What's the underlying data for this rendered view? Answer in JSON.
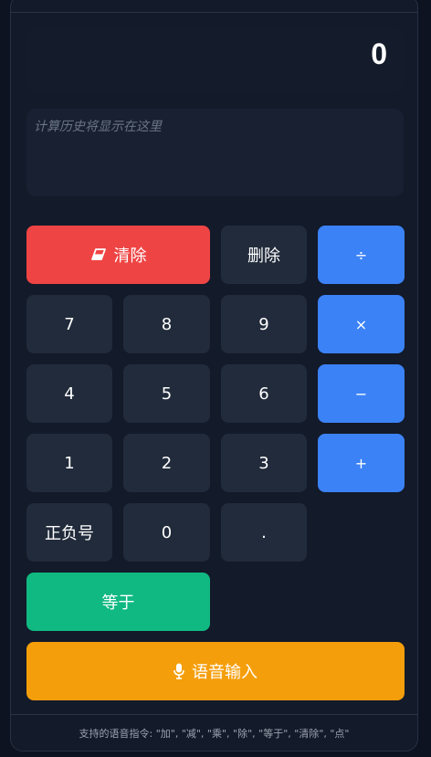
{
  "display": {
    "value": "0"
  },
  "history": {
    "placeholder": "计算历史将显示在这里"
  },
  "buttons": {
    "clear": {
      "label": "清除",
      "icon": "eraser-icon"
    },
    "delete": {
      "label": "删除"
    },
    "divide": {
      "label": "÷"
    },
    "seven": {
      "label": "7"
    },
    "eight": {
      "label": "8"
    },
    "nine": {
      "label": "9"
    },
    "multiply": {
      "label": "×"
    },
    "four": {
      "label": "4"
    },
    "five": {
      "label": "5"
    },
    "six": {
      "label": "6"
    },
    "subtract": {
      "label": "−"
    },
    "one": {
      "label": "1"
    },
    "two": {
      "label": "2"
    },
    "three": {
      "label": "3"
    },
    "add": {
      "label": "+"
    },
    "negate": {
      "label": "正负号"
    },
    "zero": {
      "label": "0"
    },
    "decimal": {
      "label": "."
    },
    "equals": {
      "label": "等于"
    },
    "voice": {
      "label": "语音输入",
      "icon": "microphone-icon"
    }
  },
  "footer": {
    "text": "支持的语音指令: \"加\", \"减\", \"乘\", \"除\", \"等于\", \"清除\", \"点\""
  },
  "colors": {
    "clear": "#ef4444",
    "operator": "#3b82f6",
    "equals": "#10b981",
    "voice": "#f59e0b",
    "number": "#212b3b"
  }
}
